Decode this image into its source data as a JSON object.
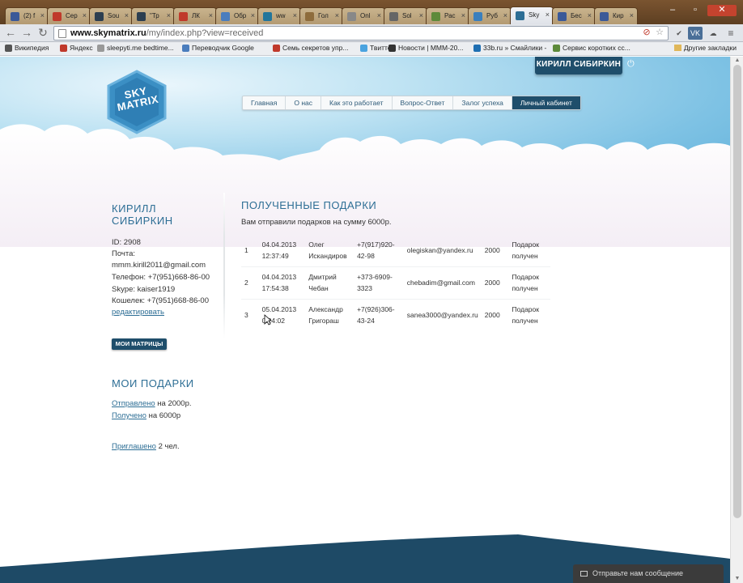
{
  "browser": {
    "tabs": [
      {
        "label": "(2) f",
        "color": "#3b5998"
      },
      {
        "label": "Сер",
        "color": "#c0392b"
      },
      {
        "label": "Sou",
        "color": "#2c3e50"
      },
      {
        "label": "\"Тр",
        "color": "#2c3e50"
      },
      {
        "label": "ЛК",
        "color": "#c0392b"
      },
      {
        "label": "Обр",
        "color": "#4a7dbd"
      },
      {
        "label": "ww",
        "color": "#21759b"
      },
      {
        "label": "Гол",
        "color": "#8e6c3c"
      },
      {
        "label": "Onl",
        "color": "#888888"
      },
      {
        "label": "Sol",
        "color": "#666666"
      },
      {
        "label": "Рас",
        "color": "#5d8a3a"
      },
      {
        "label": "Руб",
        "color": "#3a7fbd"
      },
      {
        "label": "Sky",
        "color": "#2d6e95"
      },
      {
        "label": "Бес",
        "color": "#3b5998"
      },
      {
        "label": "Кир",
        "color": "#3b5998"
      }
    ],
    "url_host": "www.skymatrix.ru",
    "url_path": "/my/index.php?view=received",
    "bookmarks": [
      "Википедия",
      "Яндекс",
      "sleepyti.me bedtime...",
      "Переводчик Google",
      "Семь секретов упр...",
      "Твиттер",
      "Новости | МММ-20...",
      "33b.ru » Смайлики -",
      "Сервис коротких сс..."
    ],
    "bookmarks_other": "Другие закладки",
    "ext_vk": "VK"
  },
  "header": {
    "logo_line1": "SKY",
    "logo_line2": "MATRIX",
    "user_button": "КИРИЛЛ СИБИРКИН",
    "nav": [
      "Главная",
      "О нас",
      "Как это работает",
      "Вопрос-Ответ",
      "Залог успеха",
      "Личный кабинет"
    ],
    "nav_active_index": 5
  },
  "sidebar": {
    "name_line1": "КИРИЛЛ",
    "name_line2": "СИБИРКИН",
    "id": "ID: 2908",
    "email_label": "Почта:",
    "email": "mmm.kirill2011@gmail.com",
    "phone": "Телефон: +7(951)668-86-00",
    "skype": "Skype: kaiser1919",
    "wallet": "Кошелек: +7(951)668-86-00",
    "edit_link": "редактировать",
    "matrices_button": "МОИ МАТРИЦЫ",
    "gifts_title": "МОИ ПОДАРКИ",
    "sent_link": "Отправлено",
    "sent_text": " на 2000р.",
    "received_link": "Получено",
    "received_text": " на 6000р",
    "invited_link": "Приглашено",
    "invited_text": " 2 чел."
  },
  "main": {
    "title": "ПОЛУЧЕННЫЕ ПОДАРКИ",
    "subtitle": "Вам отправили подарков на сумму 6000р.",
    "rows": [
      {
        "n": "1",
        "date": "04.04.2013",
        "time": "12:37:49",
        "first": "Олег",
        "last": "Искандиров",
        "phone1": "+7(917)920-",
        "phone2": "42-98",
        "email": "olegiskan@yandex.ru",
        "amount": "2000",
        "status1": "Подарок",
        "status2": "получен"
      },
      {
        "n": "2",
        "date": "04.04.2013",
        "time": "17:54:38",
        "first": "Дмитрий",
        "last": "Чебан",
        "phone1": "+373-6909-",
        "phone2": "3323",
        "email": "chebadim@gmail.com",
        "amount": "2000",
        "status1": "Подарок",
        "status2": "получен"
      },
      {
        "n": "3",
        "date": "05.04.2013",
        "time": "0:24:02",
        "first": "Александр",
        "last": "Григораш",
        "phone1": "+7(926)306-",
        "phone2": "43-24",
        "email": "sanea3000@yandex.ru",
        "amount": "2000",
        "status1": "Подарок",
        "status2": "получен"
      }
    ]
  },
  "feedback": "Отправьте нам сообщение"
}
